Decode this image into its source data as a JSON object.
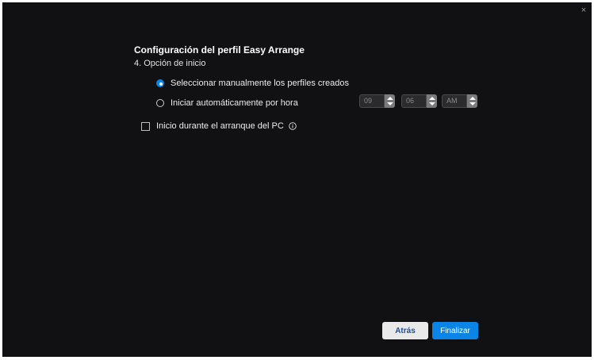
{
  "window": {
    "close_glyph": "×"
  },
  "header": {
    "title": "Configuración del perfil Easy Arrange",
    "step": "4. Opción de inicio"
  },
  "options": {
    "manual_label": "Seleccionar manualmente los perfiles creados",
    "manual_selected": true,
    "auto_label": "Iniciar automáticamente por hora",
    "auto_selected": false
  },
  "time": {
    "hour": "09",
    "minute": "06",
    "period": "AM"
  },
  "startup": {
    "label": "Inicio durante el arranque del PC",
    "checked": false
  },
  "footer": {
    "back_label": "Atrás",
    "finish_label": "Finalizar"
  },
  "colors": {
    "accent": "#0b84e8",
    "background": "#111113"
  }
}
